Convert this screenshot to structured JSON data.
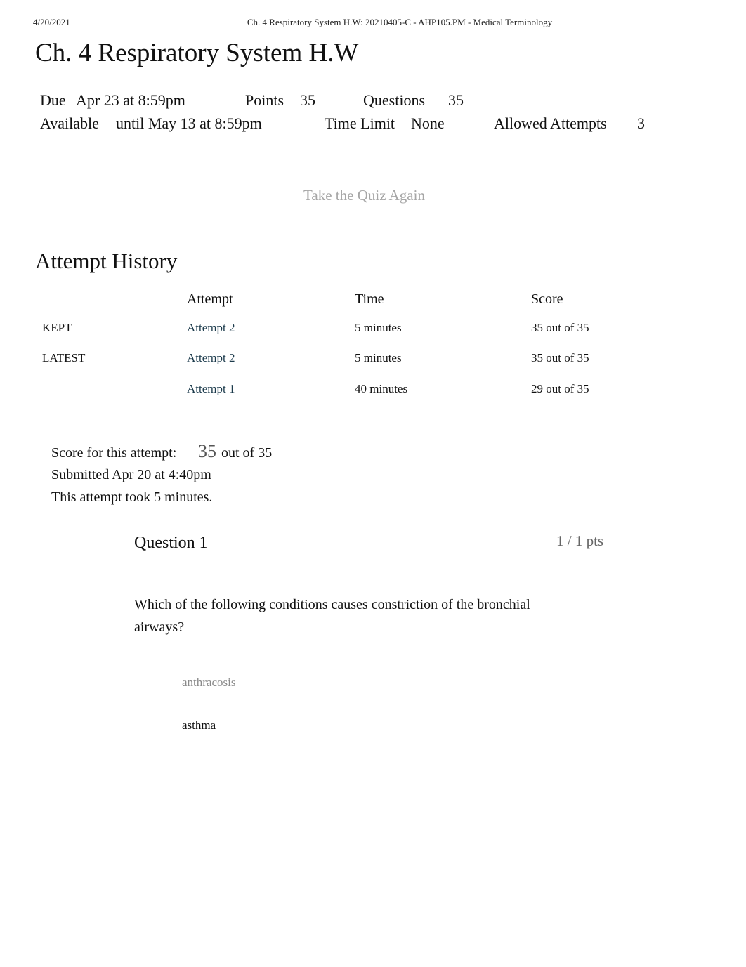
{
  "print_header": {
    "date": "4/20/2021",
    "title": "Ch. 4 Respiratory System H.W: 20210405-C - AHP105.PM - Medical Terminology"
  },
  "page_title": "Ch. 4 Respiratory System H.W",
  "quiz_details": {
    "due_label": "Due",
    "due_value": "Apr 23 at 8:59pm",
    "points_label": "Points",
    "points_value": "35",
    "questions_label": "Questions",
    "questions_value": "35",
    "available_label": "Available",
    "available_value": "until May 13 at 8:59pm",
    "time_limit_label": "Time Limit",
    "time_limit_value": "None",
    "allowed_attempts_label": "Allowed Attempts",
    "allowed_attempts_value": "3"
  },
  "retake_button_label": "Take the Quiz Again",
  "attempt_history": {
    "title": "Attempt History",
    "columns": [
      "",
      "Attempt",
      "Time",
      "Score"
    ],
    "rows": [
      {
        "tag": "KEPT",
        "attempt": "Attempt 2",
        "time": "5 minutes",
        "score": "35 out of 35"
      },
      {
        "tag": "LATEST",
        "attempt": "Attempt 2",
        "time": "5 minutes",
        "score": "35 out of 35"
      },
      {
        "tag": "",
        "attempt": "Attempt 1",
        "time": "40 minutes",
        "score": "29 out of 35"
      }
    ]
  },
  "attempt_summary": {
    "score_label": "Score for this attempt:",
    "score_value": "35",
    "score_suffix": "out of 35",
    "submitted": "Submitted Apr 20 at 4:40pm",
    "duration": "This attempt took 5 minutes."
  },
  "question": {
    "title": "Question 1",
    "points": "1 / 1 pts",
    "text": "Which of the following conditions causes constriction of the bronchial airways?",
    "answers": [
      {
        "label": "anthracosis",
        "muted": true
      },
      {
        "label": "asthma",
        "muted": false
      }
    ]
  }
}
